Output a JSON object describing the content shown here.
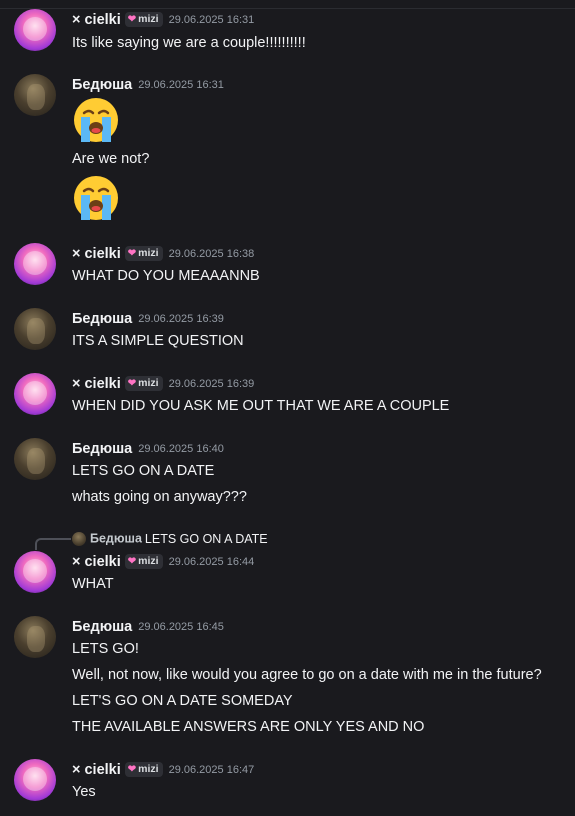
{
  "messages": [
    {
      "author": "× cielki",
      "tag": "mizi",
      "time": "29.06.2025 16:31",
      "lines": [
        "Its like saying we are a couple!!!!!!!!!!"
      ]
    },
    {
      "author": "Бедюша",
      "time": "29.06.2025 16:31",
      "emoji_1": "loudly-crying-face",
      "line_1": "Are we not?",
      "emoji_2": "loudly-crying-face"
    },
    {
      "author": "× cielki",
      "tag": "mizi",
      "time": "29.06.2025 16:38",
      "lines": [
        "WHAT DO YOU MEAAANNB"
      ]
    },
    {
      "author": "Бедюша",
      "time": "29.06.2025 16:39",
      "lines": [
        "ITS A SIMPLE QUESTION"
      ]
    },
    {
      "author": "× cielki",
      "tag": "mizi",
      "time": "29.06.2025 16:39",
      "lines": [
        "WHEN DID YOU ASK ME OUT THAT WE ARE A COUPLE"
      ]
    },
    {
      "author": "Бедюша",
      "time": "29.06.2025 16:40",
      "lines": [
        "LETS GO ON A DATE",
        "whats going on anyway???"
      ]
    },
    {
      "reply_to": {
        "author": "Бедюша",
        "text": "LETS GO ON A DATE"
      },
      "author": "× cielki",
      "tag": "mizi",
      "time": "29.06.2025 16:44",
      "lines": [
        "WHAT"
      ]
    },
    {
      "author": "Бедюша",
      "time": "29.06.2025 16:45",
      "lines": [
        "LETS GO!",
        "Well, not now, like would you agree to go on a date with me in the future?",
        "LET'S GO ON A DATE SOMEDAY",
        "THE AVAILABLE ANSWERS ARE ONLY YES AND NO"
      ]
    },
    {
      "author": "× cielki",
      "tag": "mizi",
      "time": "29.06.2025 16:47",
      "lines": [
        "Yes"
      ]
    }
  ],
  "colors": {
    "background": "#1a1a1e",
    "text": "#f2f3f5",
    "timestamp": "#949ba4",
    "tag_heart": "#ff73c4"
  }
}
